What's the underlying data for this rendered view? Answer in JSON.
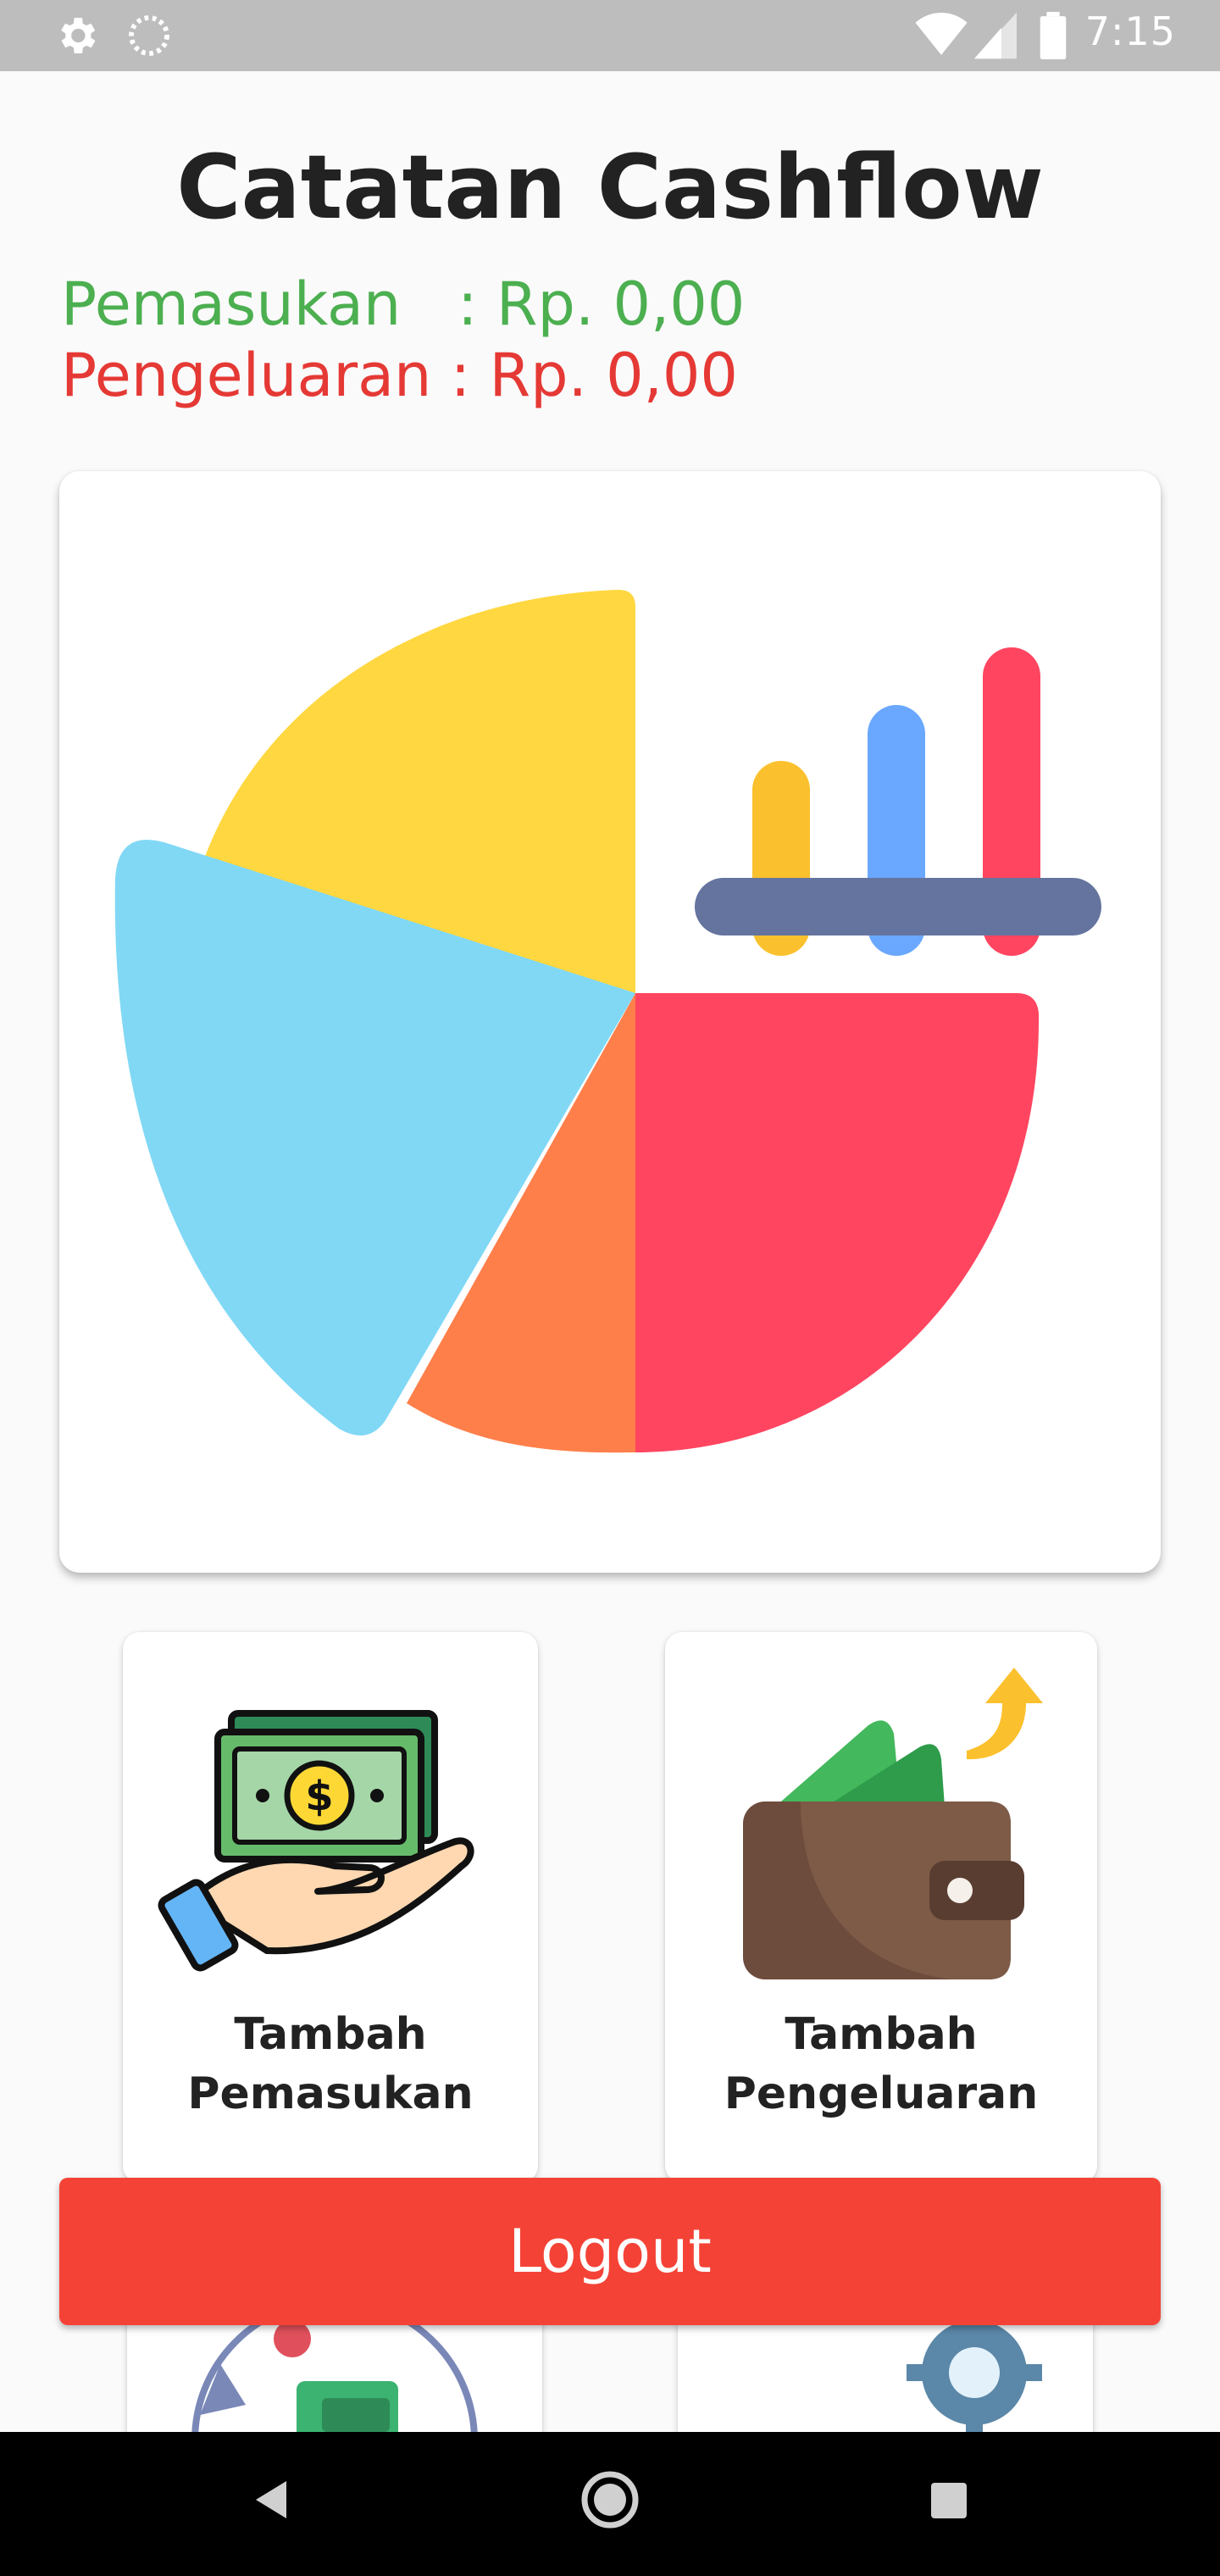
{
  "status_bar": {
    "time": "7:15",
    "icons": [
      "settings-icon",
      "loading-icon",
      "wifi-icon",
      "signal-icon",
      "battery-icon"
    ]
  },
  "header": {
    "title": "Catatan Cashflow",
    "income_label": "Pemasukan   ",
    "income_value": ": Rp. 0,00",
    "expense_label": "Pengeluaran ",
    "expense_value": ": Rp. 0,00"
  },
  "hero": {
    "illustration": "pie-chart-illustration",
    "colors": {
      "yellow": "#ffd740",
      "blue": "#80d8f5",
      "orange": "#ff7f4a",
      "red": "#ff4560",
      "bar_yellow": "#fbc02d",
      "bar_blue": "#6aa8ff",
      "bar_base": "#64749e"
    }
  },
  "menu": {
    "income_card": {
      "line1": "Tambah",
      "line2": "Pemasukan",
      "icon": "money-hand-icon"
    },
    "expense_card": {
      "line1": "Tambah",
      "line2": "Pengeluaran",
      "icon": "wallet-icon"
    },
    "lower_left_card": {
      "icon": "money-cycle-icon"
    },
    "lower_right_card": {
      "icon": "gears-icon"
    }
  },
  "logout": {
    "label": "Logout",
    "color": "#f44336"
  },
  "nav_bar": {
    "buttons": [
      "back-icon",
      "home-icon",
      "recents-icon"
    ]
  },
  "theme": {
    "income_color": "#4caf50",
    "expense_color": "#e53935"
  }
}
